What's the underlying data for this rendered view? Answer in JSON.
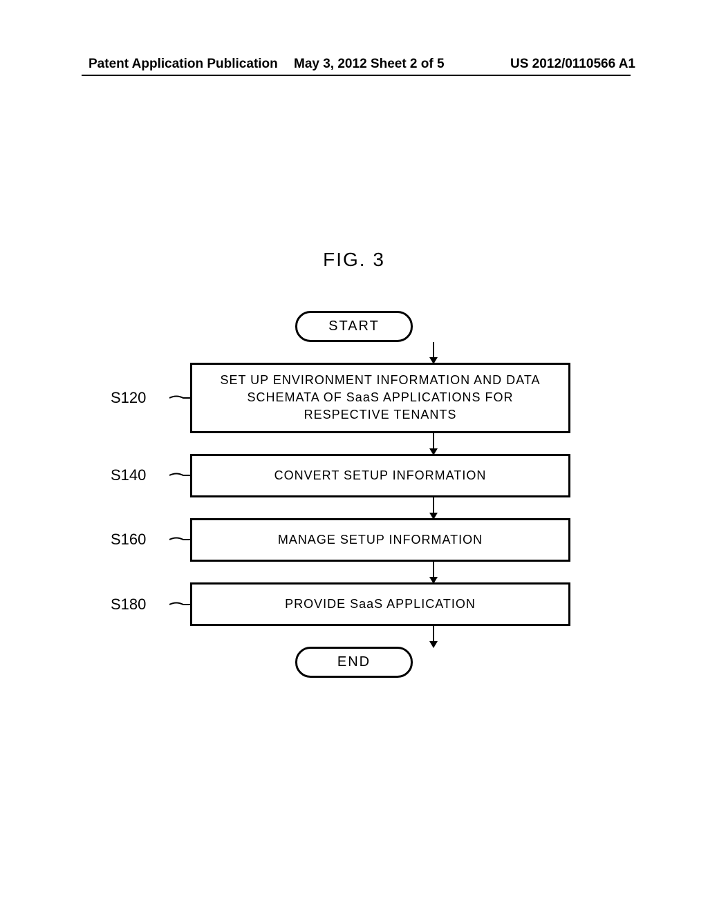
{
  "header": {
    "left": "Patent Application Publication",
    "center": "May 3, 2012  Sheet 2 of 5",
    "right": "US 2012/0110566 A1"
  },
  "figure": {
    "label": "FIG. 3"
  },
  "flowchart": {
    "start": "START",
    "end": "END",
    "steps": [
      {
        "id": "S120",
        "text": "SET UP ENVIRONMENT INFORMATION AND DATA SCHEMATA OF SaaS APPLICATIONS FOR RESPECTIVE TENANTS"
      },
      {
        "id": "S140",
        "text": "CONVERT SETUP INFORMATION"
      },
      {
        "id": "S160",
        "text": "MANAGE SETUP INFORMATION"
      },
      {
        "id": "S180",
        "text": "PROVIDE SaaS APPLICATION"
      }
    ]
  }
}
